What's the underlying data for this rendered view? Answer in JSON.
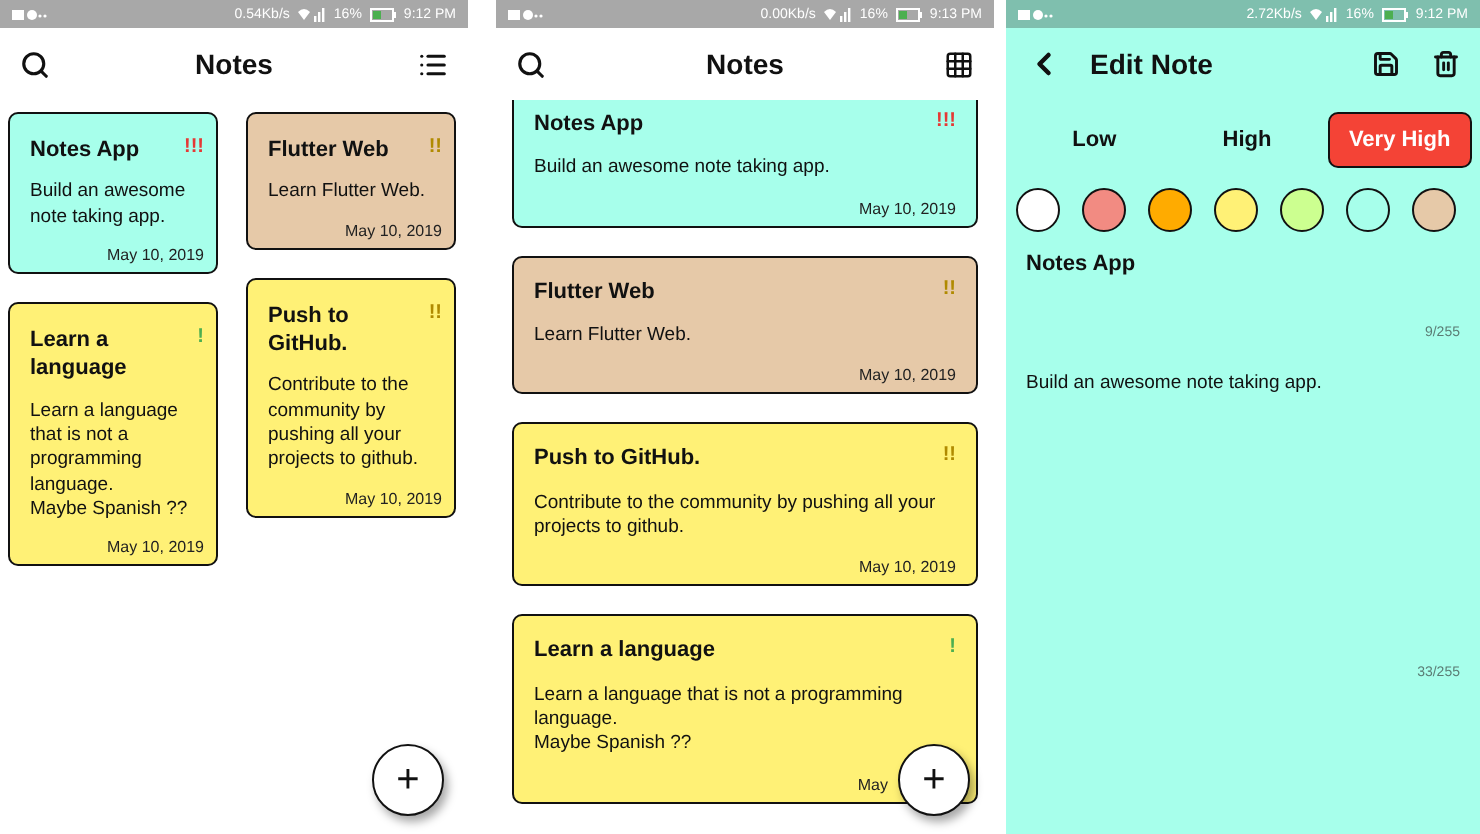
{
  "screens": [
    {
      "kind": "grid",
      "status_bar": {
        "speed": "0.54Kb/s",
        "battery": "16%",
        "time": "9:12",
        "meridiem": "PM"
      },
      "title": "Notes",
      "fab": "+",
      "columns": [
        [
          {
            "title": "Notes App",
            "priority": {
              "mark": "!!!",
              "kind": "very_high"
            },
            "color": "#a7ffeb",
            "body": "Build an awesome note taking app.",
            "date": "May 10, 2019"
          },
          {
            "title": "Learn a language",
            "priority": {
              "mark": "!",
              "kind": "low"
            },
            "color": "#fff176",
            "body": "Learn a language that is not a programming language.\nMaybe Spanish ??",
            "date": "May 10, 2019"
          }
        ],
        [
          {
            "title": "Flutter Web",
            "priority": {
              "mark": "!!",
              "kind": "high"
            },
            "color": "#e6c9a8",
            "body": "Learn Flutter Web.",
            "date": "May 10, 2019"
          },
          {
            "title": "Push to GitHub.",
            "priority": {
              "mark": "!!",
              "kind": "high"
            },
            "color": "#fff176",
            "body": "Contribute to the community by pushing all your projects to github.",
            "date": "May 10, 2019"
          }
        ]
      ]
    },
    {
      "kind": "list",
      "status_bar": {
        "speed": "0.00Kb/s",
        "battery": "16%",
        "time": "9:13",
        "meridiem": "PM"
      },
      "title": "Notes",
      "fab": "+",
      "notes": [
        {
          "title": "Notes App",
          "priority": {
            "mark": "!!!",
            "kind": "very_high"
          },
          "color": "#a7ffeb",
          "body": "Build an awesome note taking app.",
          "date": "May 10, 2019"
        },
        {
          "title": "Flutter Web",
          "priority": {
            "mark": "!!",
            "kind": "high"
          },
          "color": "#e6c9a8",
          "body": "Learn Flutter Web.",
          "date": "May 10, 2019"
        },
        {
          "title": "Push to GitHub.",
          "priority": {
            "mark": "!!",
            "kind": "high"
          },
          "color": "#fff176",
          "body": "Contribute to the community by pushing all your projects to github.",
          "date": "May 10, 2019"
        },
        {
          "title": "Learn a language",
          "priority": {
            "mark": "!",
            "kind": "low"
          },
          "color": "#fff176",
          "body": "Learn a language that is not a programming language.\nMaybe Spanish ??",
          "date": "May"
        }
      ]
    },
    {
      "kind": "edit",
      "status_bar": {
        "speed": "2.72Kb/s",
        "battery": "16%",
        "time": "9:12",
        "meridiem": "PM"
      },
      "title": "Edit Note",
      "priorities": [
        {
          "label": "Low",
          "selected": false
        },
        {
          "label": "High",
          "selected": false
        },
        {
          "label": "Very High",
          "selected": true
        }
      ],
      "colors": [
        {
          "color": "#ffffff"
        },
        {
          "color": "#f28b82"
        },
        {
          "color": "#ffab00"
        },
        {
          "color": "#fff176"
        },
        {
          "color": "#ccff90"
        },
        {
          "color": "#a7ffeb"
        },
        {
          "color": "#e6c9a8"
        }
      ],
      "title_field": {
        "value": "Notes App",
        "counter": "9/255"
      },
      "body_field": {
        "value": "Build an awesome note taking app.",
        "counter": "33/255"
      }
    }
  ]
}
